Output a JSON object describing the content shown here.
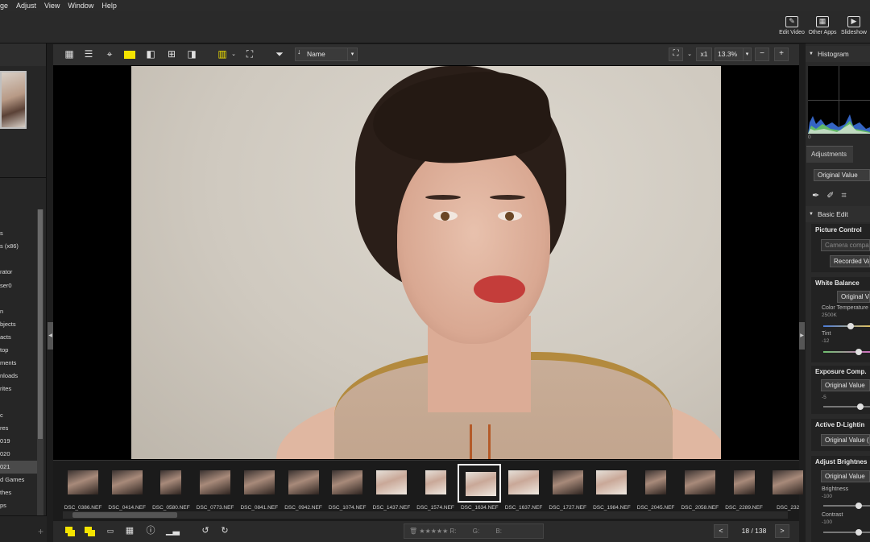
{
  "menu": [
    "ge",
    "Adjust",
    "View",
    "Window",
    "Help"
  ],
  "app_tools": [
    {
      "label": "Edit Video",
      "icon": "film-edit-icon"
    },
    {
      "label": "Other Apps",
      "icon": "apps-icon"
    },
    {
      "label": "Slideshow",
      "icon": "play-icon"
    }
  ],
  "view_toolbar": {
    "sort_label": "Name",
    "zoom_multiplier": "x1",
    "zoom_percent": "13.3%"
  },
  "folder_tree": [
    "",
    "",
    "s",
    "s (x86)",
    "",
    "rator",
    "ser0",
    "",
    "n",
    "bjects",
    "acts",
    "top",
    "ments",
    "nloads",
    "rites",
    "",
    "c",
    "res",
    "019",
    "020",
    "021",
    "d Games",
    "thes",
    "ps"
  ],
  "folder_selected_index": 20,
  "filmstrip": [
    {
      "name": "DSC_0386.NEF",
      "style": "dark"
    },
    {
      "name": "DSC_0414.NEF",
      "style": "dark"
    },
    {
      "name": "DSC_0580.NEF",
      "style": "tall"
    },
    {
      "name": "DSC_0773.NEF",
      "style": "dark"
    },
    {
      "name": "DSC_0841.NEF",
      "style": "dark"
    },
    {
      "name": "DSC_0942.NEF",
      "style": "dark"
    },
    {
      "name": "DSC_1074.NEF",
      "style": "dark"
    },
    {
      "name": "DSC_1437.NEF",
      "style": "light"
    },
    {
      "name": "DSC_1574.NEF",
      "style": "light-tall"
    },
    {
      "name": "DSC_1634.NEF",
      "style": "light",
      "selected": true
    },
    {
      "name": "DSC_1637.NEF",
      "style": "light"
    },
    {
      "name": "DSC_1727.NEF",
      "style": "dark"
    },
    {
      "name": "DSC_1984.NEF",
      "style": "light"
    },
    {
      "name": "DSC_2045.NEF",
      "style": "tall"
    },
    {
      "name": "DSC_2058.NEF",
      "style": "dark"
    },
    {
      "name": "DSC_2289.NEF",
      "style": "tall"
    },
    {
      "name": "DSC_232",
      "style": "dark"
    }
  ],
  "bottom_bar": {
    "rating_channels": [
      "R:",
      "G:",
      "B:"
    ],
    "page_indicator": "18 / 138"
  },
  "right_panel": {
    "histogram_title": "Histogram",
    "histogram_zero": "0",
    "adjust_tab": "Adjustments",
    "adjust_value": "Original Value",
    "basic_edit": "Basic Edit Palettes",
    "picture_control": {
      "title": "Picture Control",
      "field": "Camera compat",
      "recorded": "Recorded Val"
    },
    "white_balance": {
      "title": "White Balance",
      "field": "Original Va",
      "temp_label": "Color Temperature",
      "temp_value": "2500K",
      "tint_label": "Tint",
      "tint_value": "-12"
    },
    "exposure": {
      "title": "Exposure Comp.",
      "field": "Original Value",
      "value": "-5"
    },
    "d_lighting": {
      "title": "Active D-Lightin",
      "field": "Original Value (C"
    },
    "brightness": {
      "title": "Adjust Brightnes",
      "field": "Original Value",
      "brightness_label": "Brightness",
      "brightness_value": "-100",
      "contrast_label": "Contrast",
      "contrast_value": "-100"
    }
  }
}
